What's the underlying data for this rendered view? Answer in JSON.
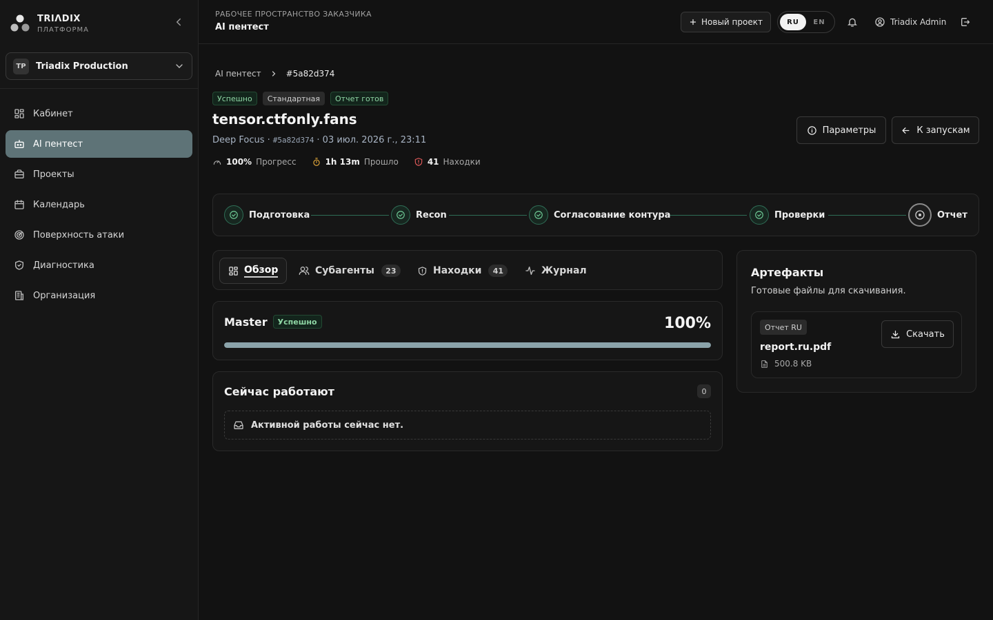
{
  "brand": {
    "name": "TRIΛDIX",
    "subtitle": "ПЛАТФОРМА"
  },
  "org": {
    "initials": "TP",
    "name": "Triadix Production"
  },
  "sidebar": {
    "items": [
      {
        "label": "Кабинет",
        "icon": "dashboard-icon"
      },
      {
        "label": "AI пентест",
        "icon": "bot-icon",
        "active": true
      },
      {
        "label": "Проекты",
        "icon": "briefcase-icon"
      },
      {
        "label": "Календарь",
        "icon": "calendar-icon"
      },
      {
        "label": "Поверхность атаки",
        "icon": "radar-icon"
      },
      {
        "label": "Диагностика",
        "icon": "shield-check-icon"
      },
      {
        "label": "Организация",
        "icon": "building-icon"
      }
    ]
  },
  "header": {
    "workspace_label": "РАБОЧЕЕ ПРОСТРАНСТВО ЗАКАЗЧИКА",
    "workspace_title": "AI пентест",
    "new_project": "Новый проект",
    "lang_ru": "RU",
    "lang_en": "EN",
    "active_lang": "RU",
    "user": "Triadix Admin"
  },
  "breadcrumb": {
    "parent": "AI пентест",
    "current": "#5a82d374"
  },
  "run": {
    "badges": [
      {
        "label": "Успешно",
        "style": "green"
      },
      {
        "label": "Стандартная",
        "style": "gray"
      },
      {
        "label": "Отчет готов",
        "style": "green"
      }
    ],
    "target": "tensor.ctfonly.fans",
    "mode": "Deep Focus",
    "id": "#5a82d374",
    "date": "03 июл. 2026 г., 23:11",
    "stats": {
      "progress_value": "100%",
      "progress_label": "Прогресс",
      "elapsed_value": "1h 13m",
      "elapsed_label": "Прошло",
      "findings_value": "41",
      "findings_label": "Находки"
    },
    "params_button": "Параметры",
    "back_button": "К запускам"
  },
  "stepper": {
    "steps": [
      {
        "label": "Подготовка",
        "state": "done"
      },
      {
        "label": "Recon",
        "state": "done"
      },
      {
        "label": "Согласование контура",
        "state": "done"
      },
      {
        "label": "Проверки",
        "state": "done"
      },
      {
        "label": "Отчет",
        "state": "current"
      }
    ]
  },
  "tabs": {
    "overview": "Обзор",
    "subagents": "Субагенты",
    "subagents_count": "23",
    "findings": "Находки",
    "findings_count": "41",
    "journal": "Журнал",
    "active": "overview"
  },
  "master": {
    "title": "Master",
    "status": "Успешно",
    "percent_text": "100%",
    "progress": 1.0
  },
  "working": {
    "title": "Сейчас работают",
    "count": "0",
    "empty": "Активной работы сейчас нет."
  },
  "artifacts": {
    "title": "Артефакты",
    "subtitle": "Готовые файлы для скачивания.",
    "files": [
      {
        "tag": "Отчет RU",
        "name": "report.ru.pdf",
        "size": "500.8 KB",
        "download": "Скачать"
      }
    ]
  },
  "colors": {
    "accent": "#5e7377",
    "success": "#6fcb96",
    "progress": "#8ba3aa",
    "background": "#121212"
  }
}
